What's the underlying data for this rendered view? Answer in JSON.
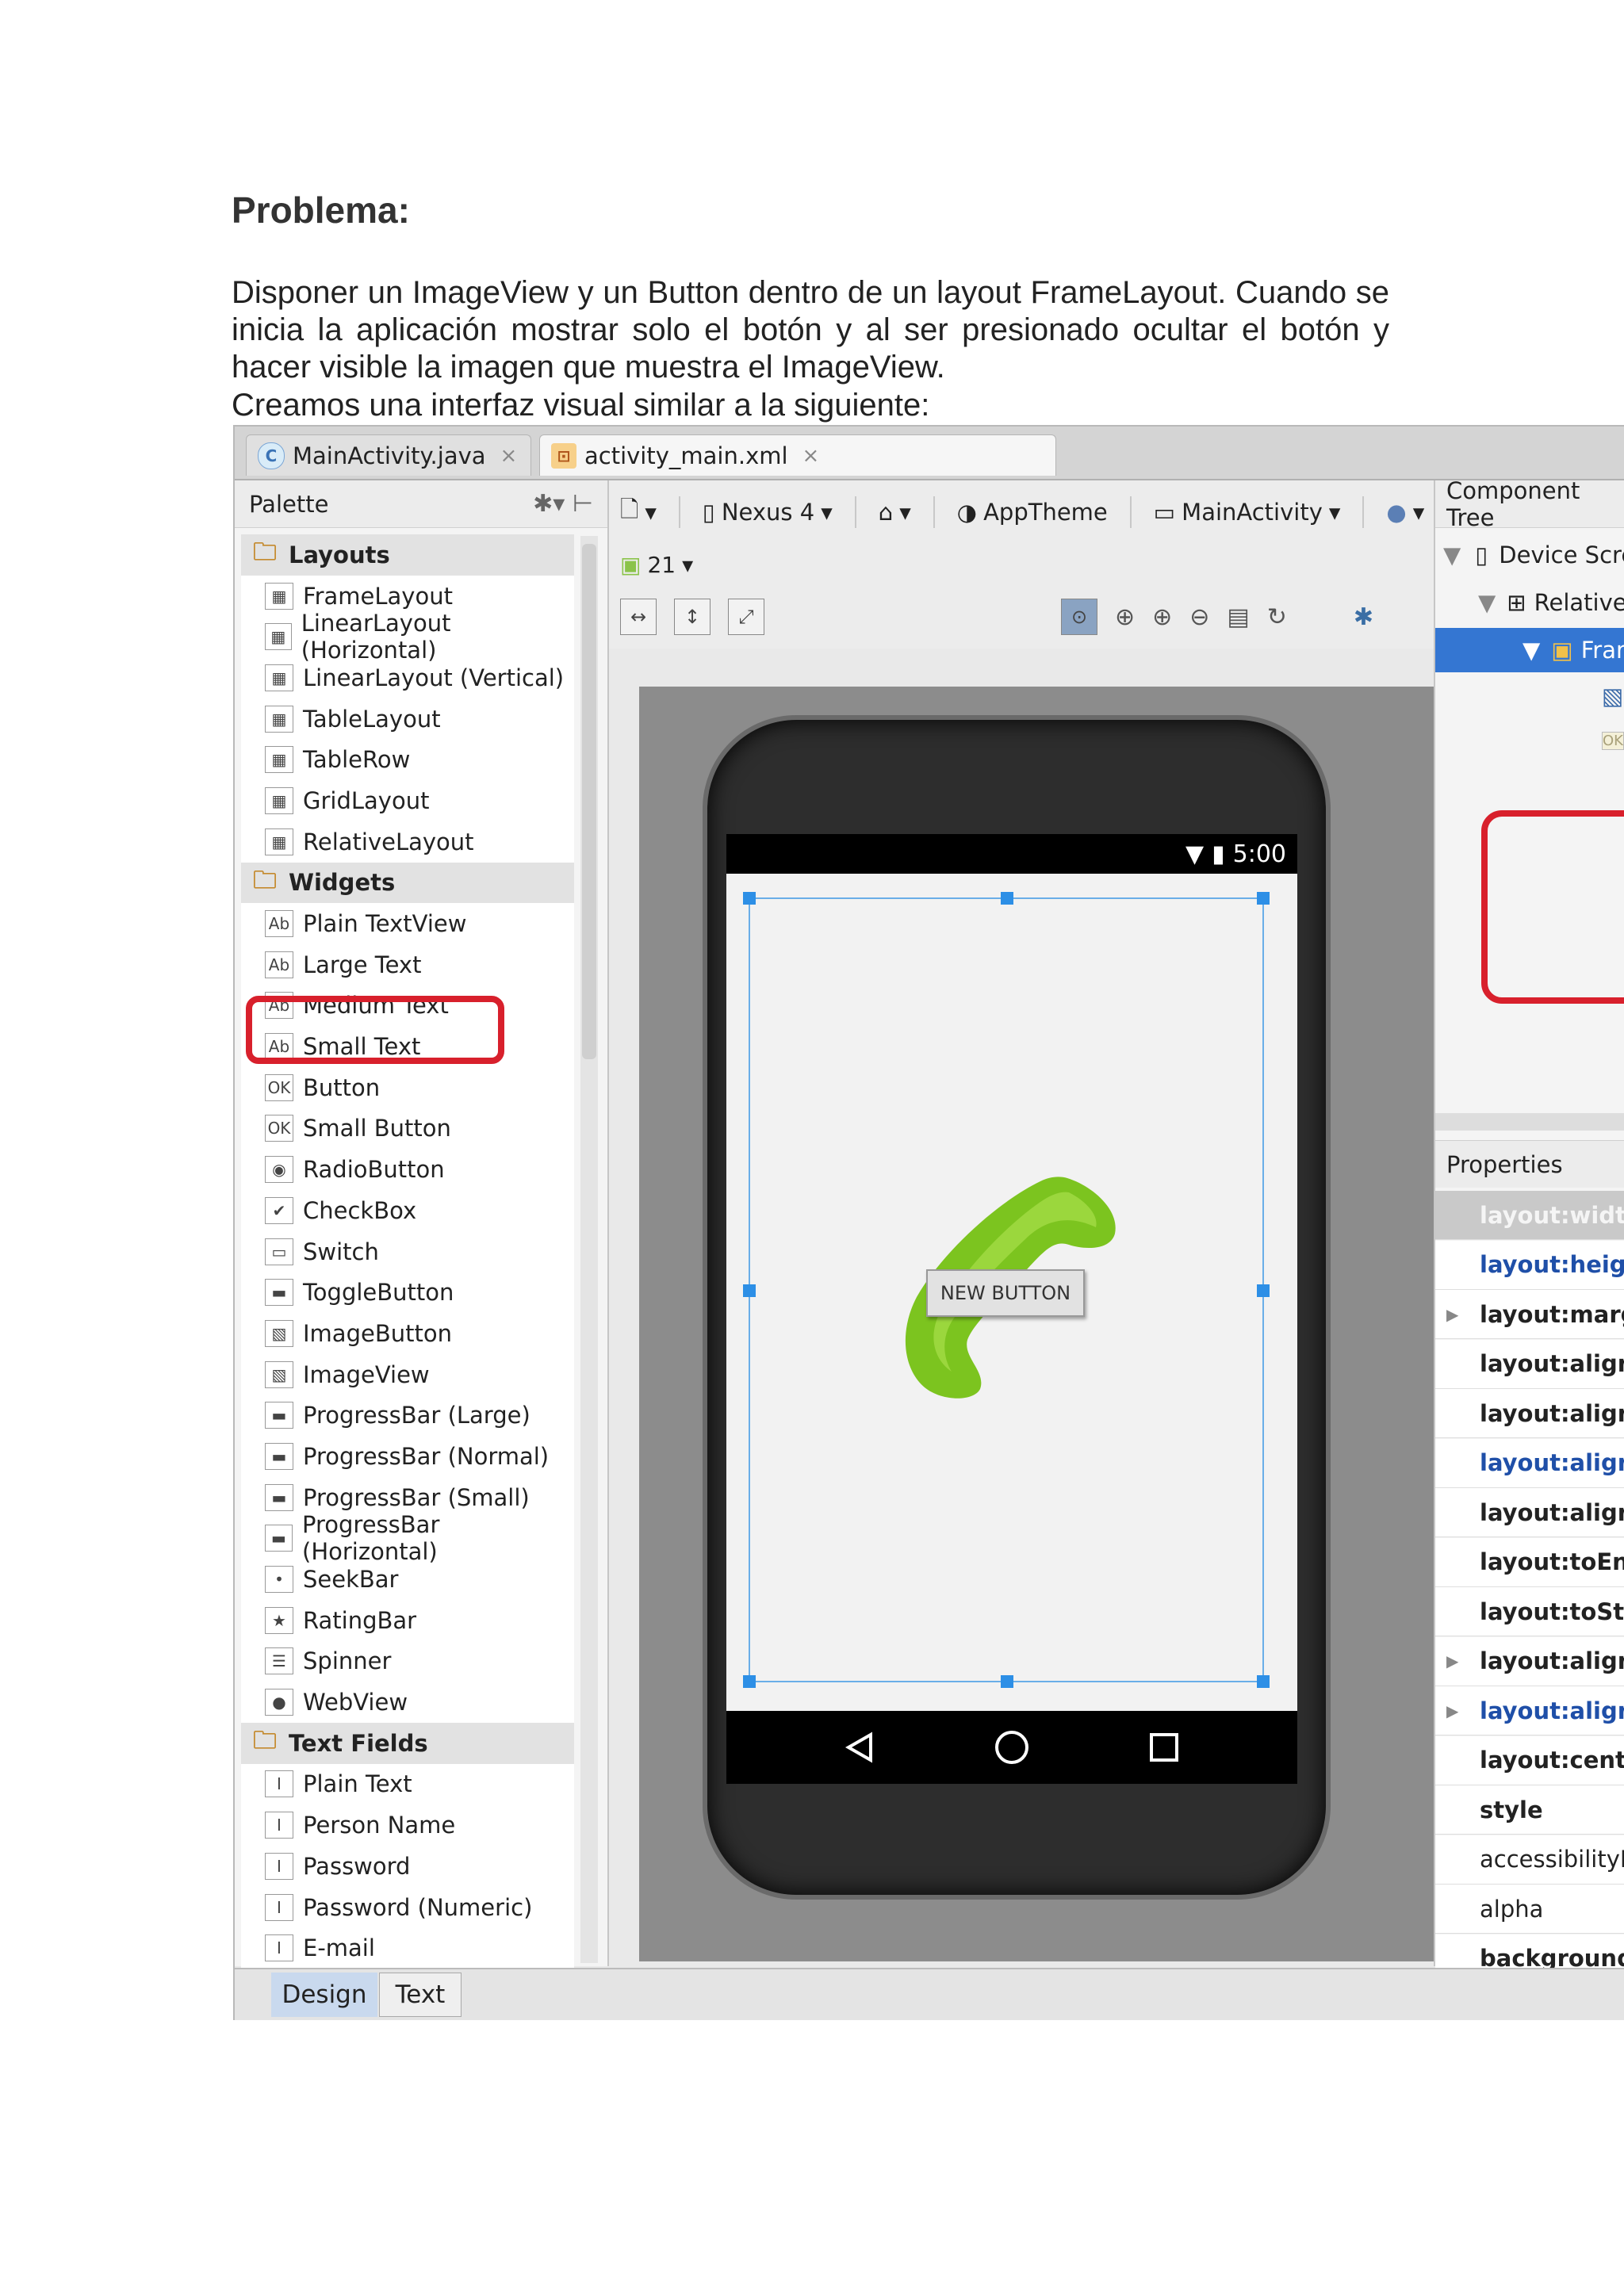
{
  "document": {
    "title": "Problema:",
    "paragraph1": "Disponer un ImageView y un Button dentro de un layout FrameLayout. Cuando se inicia la aplicación mostrar solo el botón y al ser presionado ocultar el botón y hacer visible la imagen que muestra el ImageView.",
    "paragraph2": "Creamos una interfaz visual similar a la siguiente:"
  },
  "ide": {
    "tabs": [
      {
        "label": "MainActivity.java",
        "icon": "java-class-icon"
      },
      {
        "label": "activity_main.xml",
        "icon": "xml-layout-icon"
      }
    ],
    "palette": {
      "title": "Palette",
      "items": [
        {
          "label": "Layouts",
          "category": true
        },
        {
          "label": "FrameLayout"
        },
        {
          "label": "LinearLayout (Horizontal)"
        },
        {
          "label": "LinearLayout (Vertical)"
        },
        {
          "label": "TableLayout"
        },
        {
          "label": "TableRow"
        },
        {
          "label": "GridLayout"
        },
        {
          "label": "RelativeLayout"
        },
        {
          "label": "Widgets",
          "category": true
        },
        {
          "label": "Plain TextView"
        },
        {
          "label": "Large Text"
        },
        {
          "label": "Medium Text"
        },
        {
          "label": "Small Text"
        },
        {
          "label": "Button"
        },
        {
          "label": "Small Button"
        },
        {
          "label": "RadioButton"
        },
        {
          "label": "CheckBox"
        },
        {
          "label": "Switch"
        },
        {
          "label": "ToggleButton"
        },
        {
          "label": "ImageButton"
        },
        {
          "label": "ImageView"
        },
        {
          "label": "ProgressBar (Large)"
        },
        {
          "label": "ProgressBar (Normal)"
        },
        {
          "label": "ProgressBar (Small)"
        },
        {
          "label": "ProgressBar (Horizontal)"
        },
        {
          "label": "SeekBar"
        },
        {
          "label": "RatingBar"
        },
        {
          "label": "Spinner"
        },
        {
          "label": "WebView"
        },
        {
          "label": "Text Fields",
          "category": true
        },
        {
          "label": "Plain Text"
        },
        {
          "label": "Person Name"
        },
        {
          "label": "Password"
        },
        {
          "label": "Password (Numeric)"
        },
        {
          "label": "E-mail"
        }
      ]
    },
    "toolbar": {
      "device": "Nexus 4",
      "theme": "AppTheme",
      "activity": "MainActivity",
      "api_level": "21"
    },
    "preview": {
      "status_time": "5:00",
      "button_label": "NEW BUTTON"
    },
    "component_tree": {
      "title": "Component Tree",
      "rows": [
        "Device Screen",
        "RelativeLayout",
        "FrameLayout"
      ]
    },
    "properties": {
      "title": "Properties",
      "rows": [
        {
          "label": "layout:width",
          "style": "hl"
        },
        {
          "label": "layout:height",
          "style": "blue"
        },
        {
          "label": "layout:margin",
          "style": "b",
          "expandable": true
        },
        {
          "label": "layout:alignEnd",
          "style": "b"
        },
        {
          "label": "layout:alignParentEnd",
          "style": "b"
        },
        {
          "label": "layout:alignParentStart",
          "style": "blue"
        },
        {
          "label": "layout:alignStart",
          "style": "b"
        },
        {
          "label": "layout:toEndOf",
          "style": "b"
        },
        {
          "label": "layout:toStartOf",
          "style": "b"
        },
        {
          "label": "layout:alignComponent",
          "style": "b",
          "expandable": true
        },
        {
          "label": "layout:alignParent",
          "style": "blue",
          "expandable": true
        },
        {
          "label": "layout:centerInParent",
          "style": "b"
        },
        {
          "label": "style",
          "style": "b"
        },
        {
          "label": "accessibilityLiveRegion",
          "style": ""
        },
        {
          "label": "alpha",
          "style": ""
        },
        {
          "label": "background",
          "style": "b"
        }
      ]
    },
    "bottom_tabs": {
      "design": "Design",
      "text": "Text"
    },
    "colors": {
      "accent": "#3476d2",
      "highlight_red": "#d8202c",
      "phone_icon_green": "#7cc41f"
    }
  }
}
